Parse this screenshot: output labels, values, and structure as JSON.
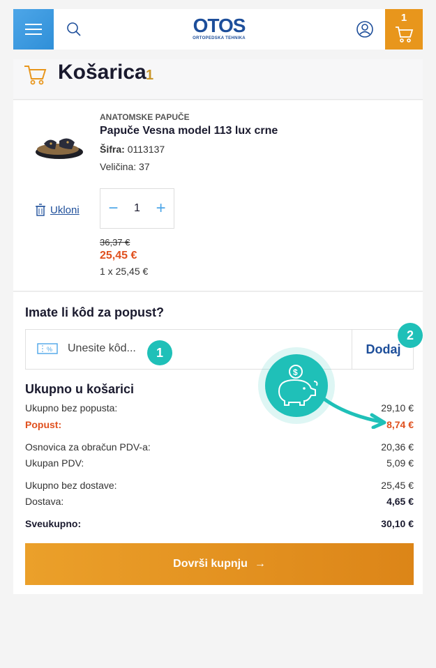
{
  "header": {
    "logo_main": "OTOS",
    "logo_sub": "ORTOPEDSKA TEHNIKA",
    "cart_count": "1"
  },
  "title": {
    "text": "Košarica",
    "count": "1"
  },
  "product": {
    "category": "ANATOMSKE PAPUČE",
    "name": "Papuče Vesna model 113 lux crne",
    "code_label": "Šifra:",
    "code_value": "0113137",
    "size": "Veličina: 37",
    "remove_label": "Ukloni",
    "quantity": "1",
    "old_price": "36,37 €",
    "new_price": "25,45 €",
    "unit_price": "1 x 25,45 €"
  },
  "coupon": {
    "title": "Imate li kôd za popust?",
    "placeholder": "Unesite kôd...",
    "add_label": "Dodaj",
    "badge_1": "1",
    "badge_2": "2"
  },
  "totals": {
    "title": "Ukupno u košarici",
    "rows": [
      {
        "label": "Ukupno bez popusta:",
        "value": "29,10 €"
      },
      {
        "label": "Popust:",
        "value": "8,74 €"
      },
      {
        "label": "Osnovica za obračun PDV-a:",
        "value": "20,36 €"
      },
      {
        "label": "Ukupan PDV:",
        "value": "5,09 €"
      },
      {
        "label": "Ukupno bez dostave:",
        "value": "25,45 €"
      },
      {
        "label": "Dostava:",
        "value": "4,65 €"
      },
      {
        "label": "Sveukupno:",
        "value": "30,10 €"
      }
    ]
  },
  "checkout": {
    "label": "Dovrši kupnju",
    "arrow": "→"
  },
  "colors": {
    "brand_blue": "#1d4e9a",
    "accent_orange": "#e8961c",
    "discount_red": "#e0501e",
    "teal": "#1fc0b8"
  }
}
